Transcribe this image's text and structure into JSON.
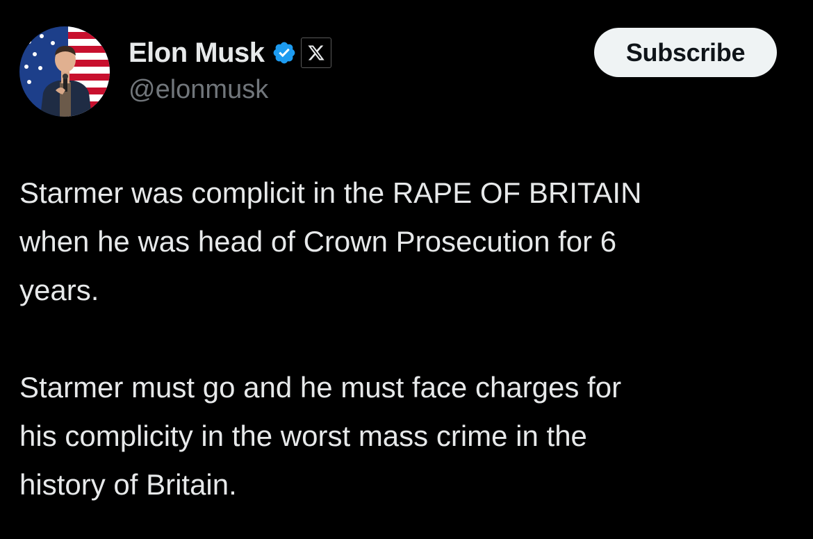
{
  "post": {
    "author": {
      "name": "Elon Musk",
      "handle": "@elonmusk",
      "verified": true,
      "avatar_icon": "profile-photo",
      "badge_icon": "x-logo-icon"
    },
    "subscribe_label": "Subscribe",
    "paragraphs": [
      {
        "lines": [
          "Starmer was complicit in the RAPE OF BRITAIN",
          "when he was head of Crown Prosecution for 6",
          "years."
        ]
      },
      {
        "lines": [
          "Starmer must go and he must face charges for",
          "his complicity in the worst mass crime in the",
          "history of Britain."
        ]
      }
    ]
  },
  "colors": {
    "background": "#000000",
    "text_primary": "#e7e9ea",
    "text_secondary": "#71767b",
    "verified_blue": "#1d9bf0",
    "button_bg": "#eff3f4",
    "button_text": "#0f1419"
  }
}
